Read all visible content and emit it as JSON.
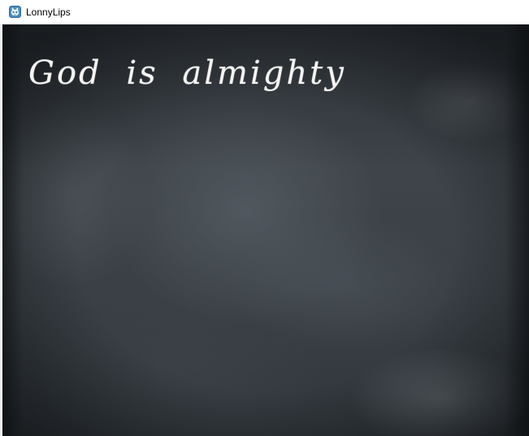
{
  "window": {
    "title": "LonnyLips",
    "icon": "godot-engine-icon"
  },
  "canvas": {
    "chalk_text": "God is almighty",
    "background": "chalkboard"
  }
}
